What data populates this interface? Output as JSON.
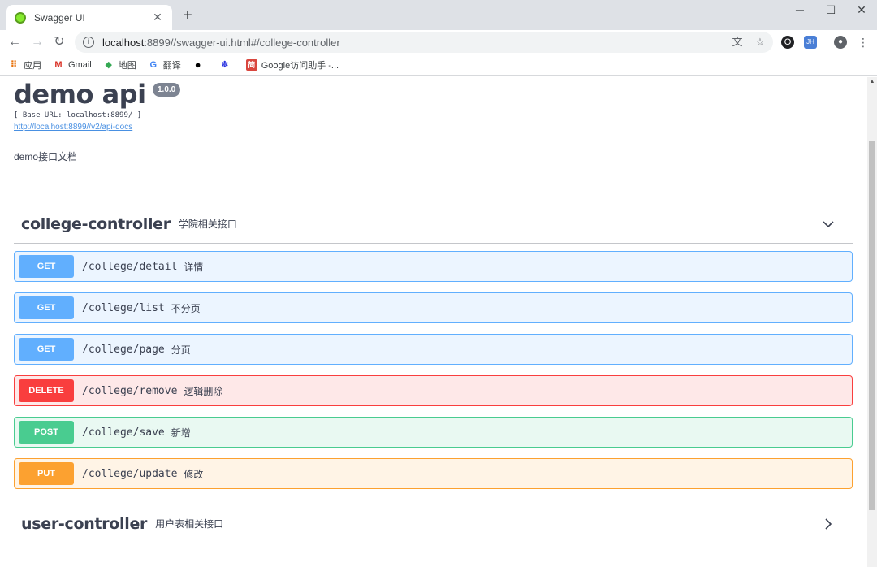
{
  "browser": {
    "tab_title": "Swagger UI",
    "tab_close": "✕",
    "new_tab": "+",
    "window_controls": {
      "minimize": "─",
      "maximize": "☐",
      "close": "✕"
    },
    "url_host": "localhost",
    "url_path": ":8899//swagger-ui.html#/college-controller",
    "info_icon": "i",
    "bookmarks": [
      {
        "label": "应用",
        "icon": "apps-grid-icon"
      },
      {
        "label": "Gmail",
        "icon": "gmail-icon"
      },
      {
        "label": "地图",
        "icon": "maps-icon"
      },
      {
        "label": "翻译",
        "icon": "translate-icon"
      },
      {
        "label": "",
        "icon": "github-icon"
      },
      {
        "label": "",
        "icon": "baidu-paw-icon"
      },
      {
        "label": "Google访问助手 -...",
        "icon": "jian-icon"
      }
    ],
    "extension_badge": "JH"
  },
  "page": {
    "title": "demo api",
    "version": "1.0.0",
    "base_url": "[ Base URL: localhost:8899/ ]",
    "docs_link": "http://localhost:8899//v2/api-docs",
    "description": "demo接口文档"
  },
  "tags": [
    {
      "name": "college-controller",
      "description": "学院相关接口",
      "expanded": true
    },
    {
      "name": "user-controller",
      "description": "用户表相关接口",
      "expanded": false
    }
  ],
  "operations": [
    {
      "method": "GET",
      "path": "/college/detail",
      "summary": "详情",
      "color": "#61affe"
    },
    {
      "method": "GET",
      "path": "/college/list",
      "summary": "不分页",
      "color": "#61affe"
    },
    {
      "method": "GET",
      "path": "/college/page",
      "summary": "分页",
      "color": "#61affe"
    },
    {
      "method": "DELETE",
      "path": "/college/remove",
      "summary": "逻辑删除",
      "color": "#f93e3e"
    },
    {
      "method": "POST",
      "path": "/college/save",
      "summary": "新增",
      "color": "#49cc90"
    },
    {
      "method": "PUT",
      "path": "/college/update",
      "summary": "修改",
      "color": "#fca130"
    }
  ]
}
